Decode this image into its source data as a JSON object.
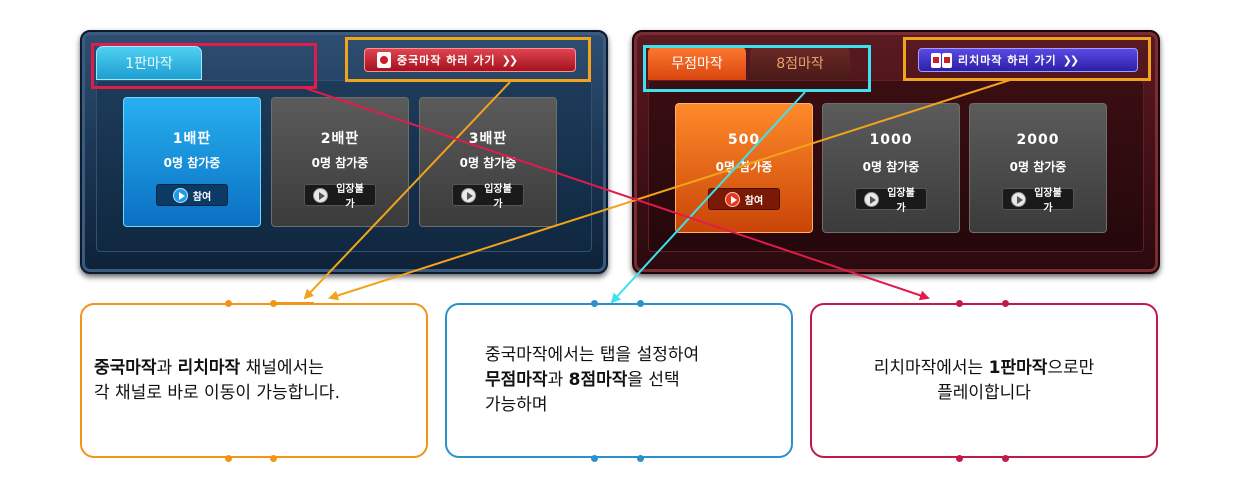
{
  "riichi_panel": {
    "tab_label": "1판마작",
    "goto_button": "중국마작 하러 가기",
    "goto_icon": "mahjong-tile-icon",
    "cards": [
      {
        "title": "1배판",
        "count": "0명 참가중",
        "button": "참여",
        "active": true
      },
      {
        "title": "2배판",
        "count": "0명 참가중",
        "button": "입장불가",
        "active": false
      },
      {
        "title": "3배판",
        "count": "0명 참가중",
        "button": "입장불가",
        "active": false
      }
    ]
  },
  "chinese_panel": {
    "tabs": [
      "무점마작",
      "8점마작"
    ],
    "goto_button": "리치마작 하러 가기",
    "goto_icon": "mahjong-tiles-icon",
    "cards": [
      {
        "title": "500",
        "count": "0명 참가중",
        "button": "참여",
        "active": true
      },
      {
        "title": "1000",
        "count": "0명 참가중",
        "button": "입장불가",
        "active": false
      },
      {
        "title": "2000",
        "count": "0명 참가중",
        "button": "입장불가",
        "active": false
      }
    ]
  },
  "callouts": {
    "orange": {
      "bold1": "중국마작",
      "t1": "과 ",
      "bold2": "리치마작",
      "t2": " 채널에서는",
      "line2": "각 채널로 바로 이동이 가능합니다."
    },
    "blue": {
      "line1": "중국마작에서는 탭을 설정하여",
      "bold1": "무점마작",
      "t1": "과 ",
      "bold2": "8점마작",
      "t2": "을 선택",
      "line3": "가능하며"
    },
    "red": {
      "t1": "리치마작에서는 ",
      "bold1": "1판마작",
      "t2": "으로만",
      "line2": "플레이합니다"
    }
  },
  "colors": {
    "orange": "#f39318",
    "blue": "#2a92c9",
    "red": "#c01b47",
    "cyan": "#3ee2ee",
    "crimson": "#e21b4d"
  }
}
